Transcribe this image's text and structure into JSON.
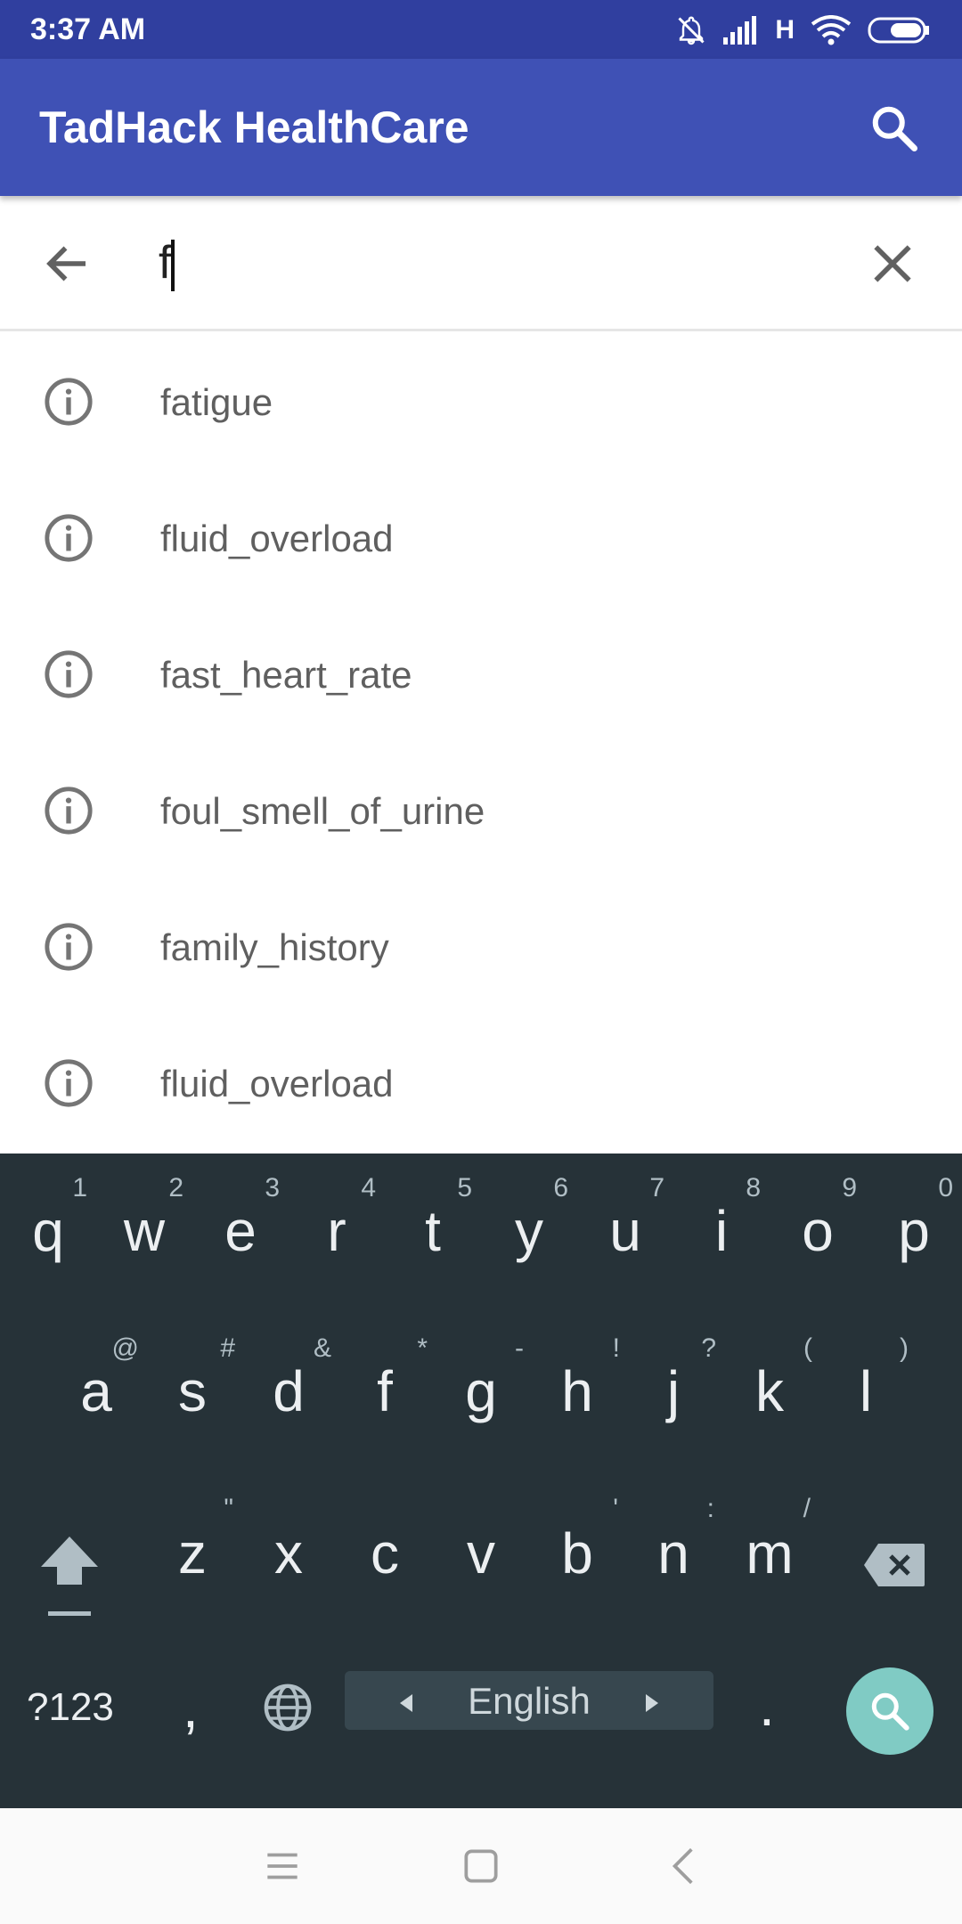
{
  "status_bar": {
    "time": "3:37 AM",
    "network": "H",
    "icons": [
      "mute-icon",
      "signal-icon",
      "wifi-icon",
      "battery-icon"
    ]
  },
  "app_bar": {
    "title": "TadHack HealthCare",
    "background": "#3f51b5",
    "status_background": "#303f9f"
  },
  "search": {
    "query": "f"
  },
  "suggestions": [
    {
      "label": "fatigue"
    },
    {
      "label": "fluid_overload"
    },
    {
      "label": "fast_heart_rate"
    },
    {
      "label": "foul_smell_of_urine"
    },
    {
      "label": "family_history"
    },
    {
      "label": "fluid_overload"
    }
  ],
  "keyboard": {
    "row1": [
      {
        "key": "q",
        "hint": "1"
      },
      {
        "key": "w",
        "hint": "2"
      },
      {
        "key": "e",
        "hint": "3"
      },
      {
        "key": "r",
        "hint": "4"
      },
      {
        "key": "t",
        "hint": "5"
      },
      {
        "key": "y",
        "hint": "6"
      },
      {
        "key": "u",
        "hint": "7"
      },
      {
        "key": "i",
        "hint": "8"
      },
      {
        "key": "o",
        "hint": "9"
      },
      {
        "key": "p",
        "hint": "0"
      }
    ],
    "row2": [
      {
        "key": "a",
        "hint": "@"
      },
      {
        "key": "s",
        "hint": "#"
      },
      {
        "key": "d",
        "hint": "&"
      },
      {
        "key": "f",
        "hint": "*"
      },
      {
        "key": "g",
        "hint": "-"
      },
      {
        "key": "h",
        "hint": "!"
      },
      {
        "key": "j",
        "hint": "?"
      },
      {
        "key": "k",
        "hint": "("
      },
      {
        "key": "l",
        "hint": ")"
      }
    ],
    "row3": [
      {
        "key": "z",
        "hint": "\""
      },
      {
        "key": "x",
        "hint": ""
      },
      {
        "key": "c",
        "hint": ""
      },
      {
        "key": "v",
        "hint": ""
      },
      {
        "key": "b",
        "hint": "'"
      },
      {
        "key": "n",
        "hint": ":"
      },
      {
        "key": "m",
        "hint": "/"
      }
    ],
    "symbols_label": "?123",
    "comma": ",",
    "period": ".",
    "language": "English",
    "background": "#263238",
    "action_color": "#80cbc4"
  }
}
